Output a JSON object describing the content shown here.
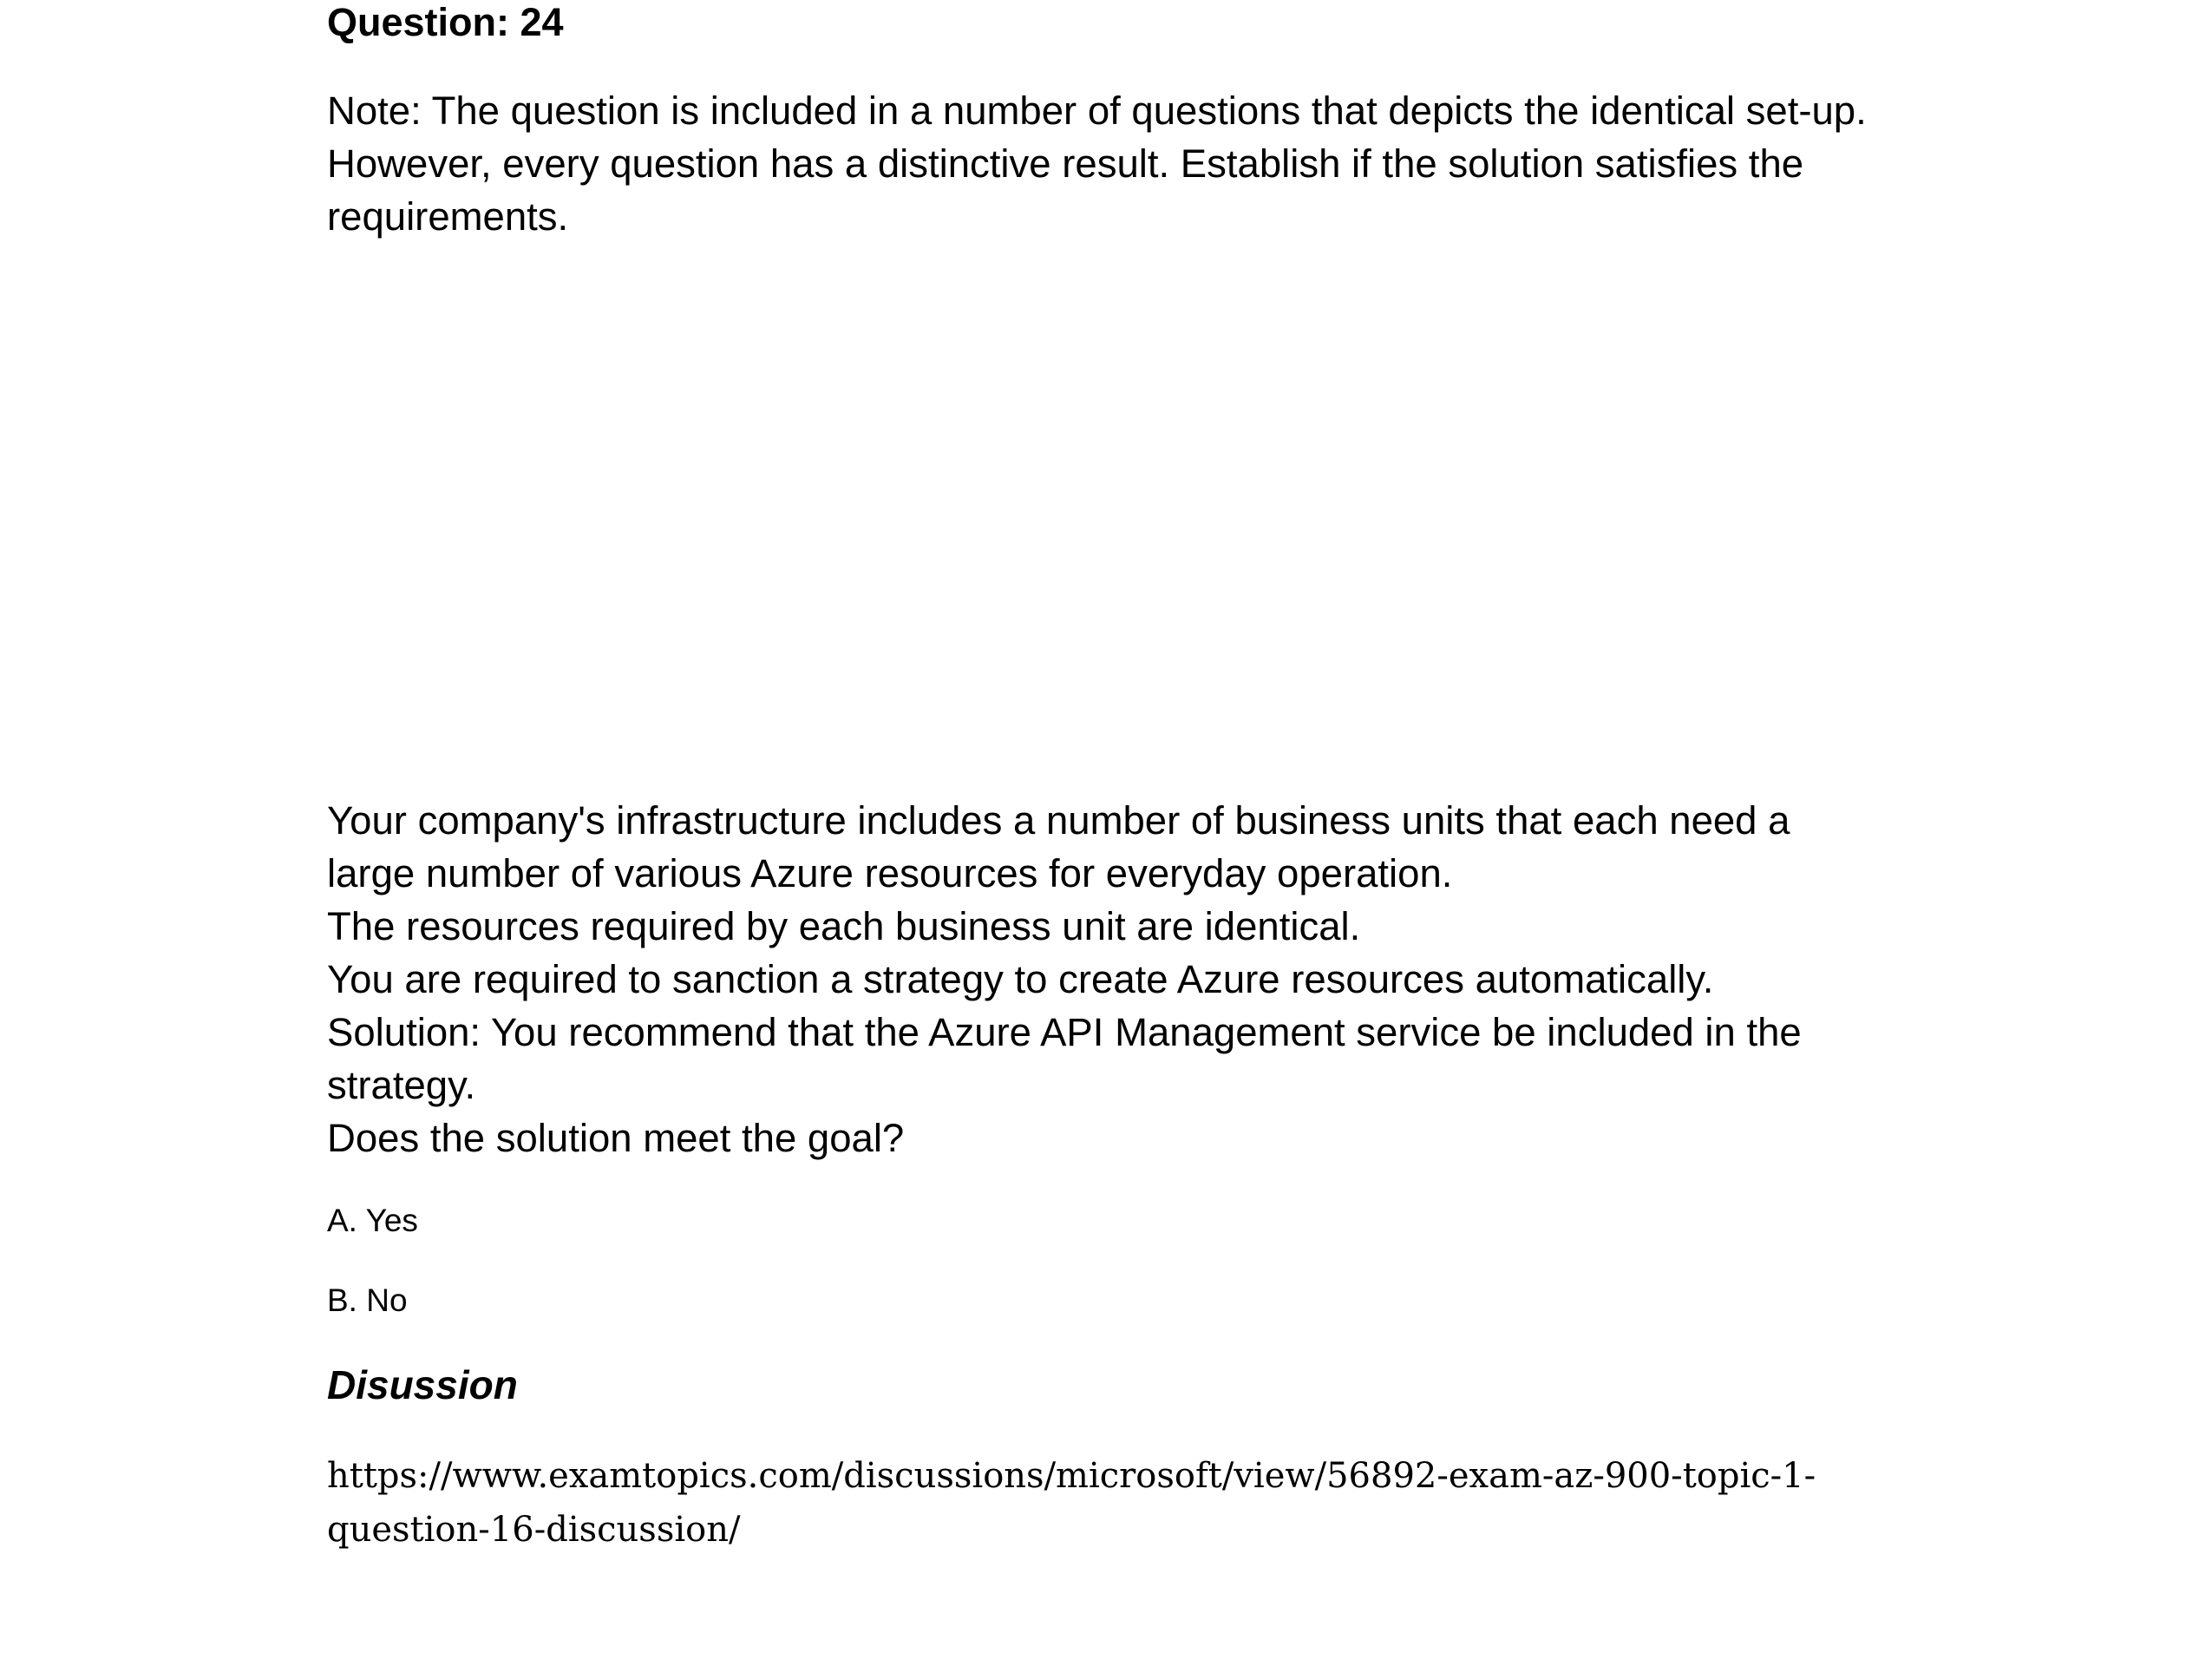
{
  "question": {
    "title": "Question: 24"
  },
  "note": {
    "lines": [
      "Note: The question is included in a number of questions that depicts the identical set-up.",
      "However, every question has a distinctive result. Establish if the solution satisfies the",
      "requirements."
    ]
  },
  "scenario": {
    "lines": [
      "Your company's infrastructure includes a number of business units that each need a",
      "large number of various Azure resources for everyday operation.",
      "The resources required by each business unit are identical.",
      "You are required to sanction a strategy to create Azure resources automatically.",
      "Solution: You recommend that the Azure API Management service be included in the",
      "strategy.",
      "Does the solution meet the goal?"
    ]
  },
  "options": [
    {
      "label": "A. Yes"
    },
    {
      "label": "B. No"
    }
  ],
  "discussion": {
    "heading": "Disussion",
    "link_lines": [
      "https://www.examtopics.com/discussions/microsoft/view/56892-exam-az-900-topic-1-",
      "question-16-discussion/"
    ]
  }
}
